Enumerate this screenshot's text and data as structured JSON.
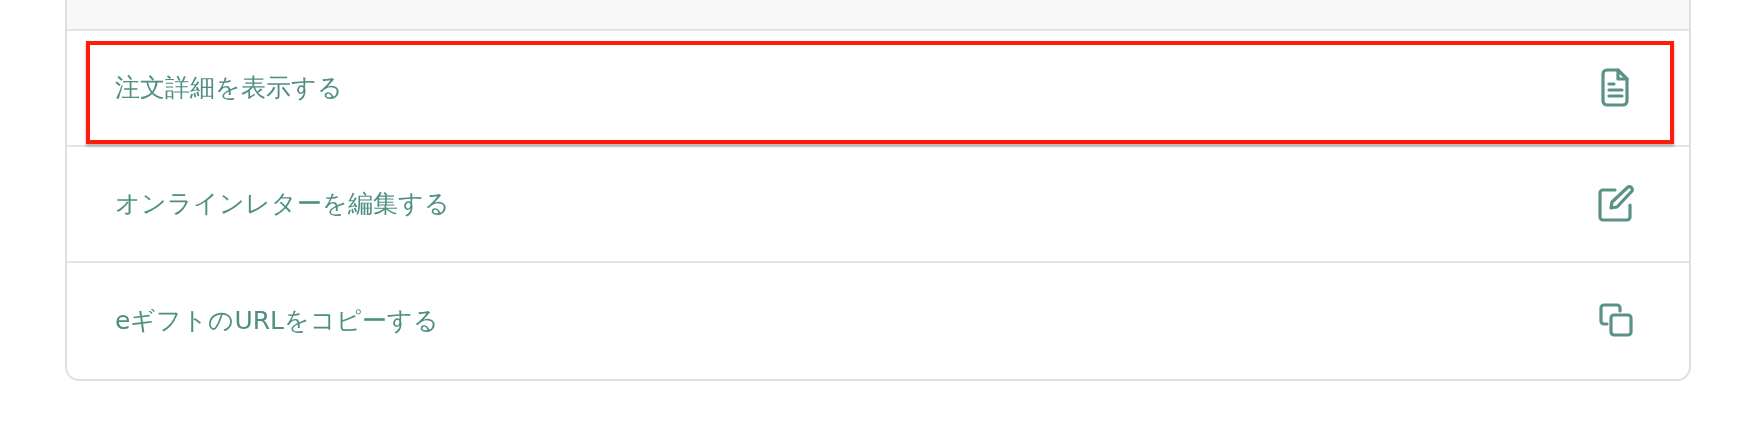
{
  "menu": {
    "items": [
      {
        "label": "注文詳細を表示する",
        "highlighted": true
      },
      {
        "label": "オンラインレターを編集する",
        "highlighted": false
      },
      {
        "label": "eギフトのURLをコピーする",
        "highlighted": false
      }
    ]
  }
}
